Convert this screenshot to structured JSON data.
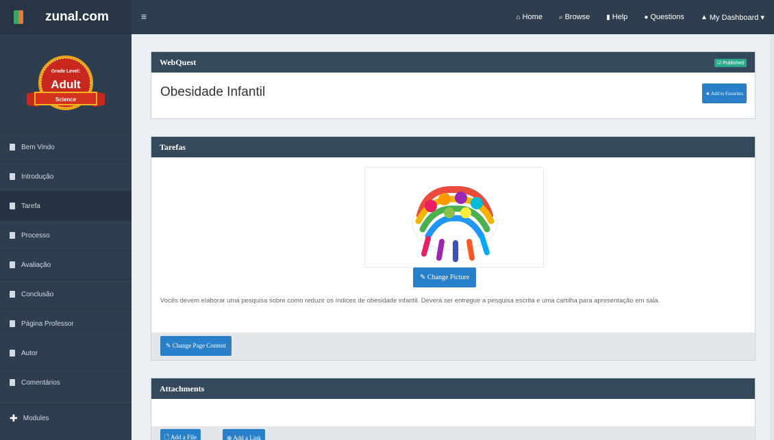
{
  "brand": {
    "name": "zunal.com"
  },
  "topnav": {
    "menu_icon": "≡",
    "items": [
      {
        "icon": "home-icon",
        "glyph": "🏠",
        "label": "Home"
      },
      {
        "icon": "search-icon",
        "glyph": "🔍",
        "label": "Browse"
      },
      {
        "icon": "book-icon",
        "glyph": "📖",
        "label": "Help"
      },
      {
        "icon": "comments-icon",
        "glyph": "💬",
        "label": "Questions"
      },
      {
        "icon": "user-icon",
        "glyph": "👤",
        "label": "My Dashboard ▾"
      }
    ]
  },
  "badge": {
    "top": "Grade Level:",
    "main": "Adult",
    "ribbon": "Science"
  },
  "sidebar": {
    "items": [
      {
        "label": "Bem Vindo"
      },
      {
        "label": "Introdução"
      },
      {
        "label": "Tarefa"
      },
      {
        "label": "Processo"
      },
      {
        "label": "Avaliação"
      },
      {
        "label": "Conclusão"
      },
      {
        "label": "Página Professor"
      },
      {
        "label": "Autor"
      },
      {
        "label": "Comentários"
      }
    ],
    "modules": "Modules"
  },
  "webquest": {
    "header": "WebQuest",
    "status": "☑ Published",
    "title": "Obesidade Infantil",
    "favorites": "★ Add to Favorites"
  },
  "tarefas": {
    "header": "Tarefas",
    "change_picture": "✎ Change Picture",
    "description": "Vocês devem elaborar uma pesquisa sobre como reduzir os índices de obesidade infantil. Deverá ser entregue a pesquisa escrita e uma cartilha para apresentação em sala.",
    "change_content": "✎ Change Page Content"
  },
  "attachments": {
    "header": "Attachments",
    "add_file": "🗋 Add a File",
    "add_link": "⊕ Add a Link"
  },
  "colors": {
    "topbar": "#2f3e4e",
    "panel_header": "#35495d",
    "button": "#2a80c8",
    "published": "#2aab8a"
  }
}
